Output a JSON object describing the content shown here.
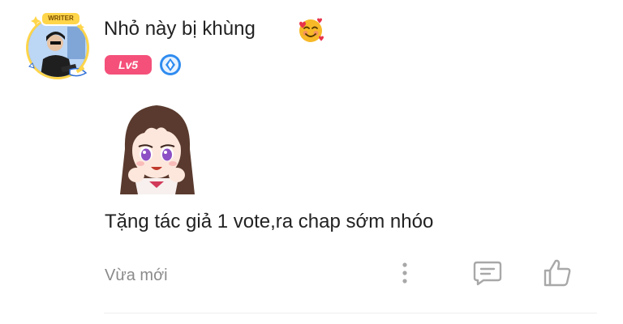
{
  "user": {
    "name": "Nhỏ này bị khùng",
    "avatar_tag": "WRITER",
    "level": "Lv5",
    "emoji_icon": "smiling-face-with-hearts-icon",
    "rank_icon": "blue-diamond-rank-icon"
  },
  "comment": {
    "sticker_icon": "anime-girl-sticker",
    "text": "Tặng tác giả 1 vote,ra chap sớm nhóo",
    "time": "Vừa mới"
  },
  "actions": {
    "more_icon": "more-vertical-icon",
    "reply_icon": "comment-icon",
    "like_icon": "thumbs-up-icon"
  },
  "colors": {
    "level_badge": "#f4507a",
    "rank_badge": "#2f8cf0",
    "text": "#222222",
    "muted": "#8a8a8a"
  }
}
